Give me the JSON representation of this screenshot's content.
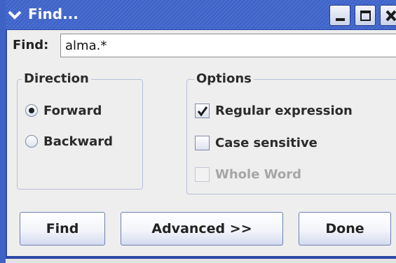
{
  "window": {
    "title": "Find...",
    "accent_color": "#4a6ed0",
    "title_text_color": "#ffffff"
  },
  "titlebar": {
    "menu_icon": "chevron-down-icon",
    "minimize_icon": "minimize-icon",
    "maximize_icon": "maximize-icon",
    "close_icon": "close-icon"
  },
  "find": {
    "label": "Find:",
    "value": "alma.*"
  },
  "direction": {
    "title": "Direction",
    "options": [
      {
        "label": "Forward",
        "checked": true
      },
      {
        "label": "Backward",
        "checked": false
      }
    ]
  },
  "options": {
    "title": "Options",
    "items": [
      {
        "label": "Regular expression",
        "checked": true,
        "enabled": true
      },
      {
        "label": "Case sensitive",
        "checked": false,
        "enabled": true
      },
      {
        "label": "Whole Word",
        "checked": false,
        "enabled": false
      }
    ]
  },
  "buttons": {
    "find": "Find",
    "advanced": "Advanced >>",
    "done": "Done"
  }
}
